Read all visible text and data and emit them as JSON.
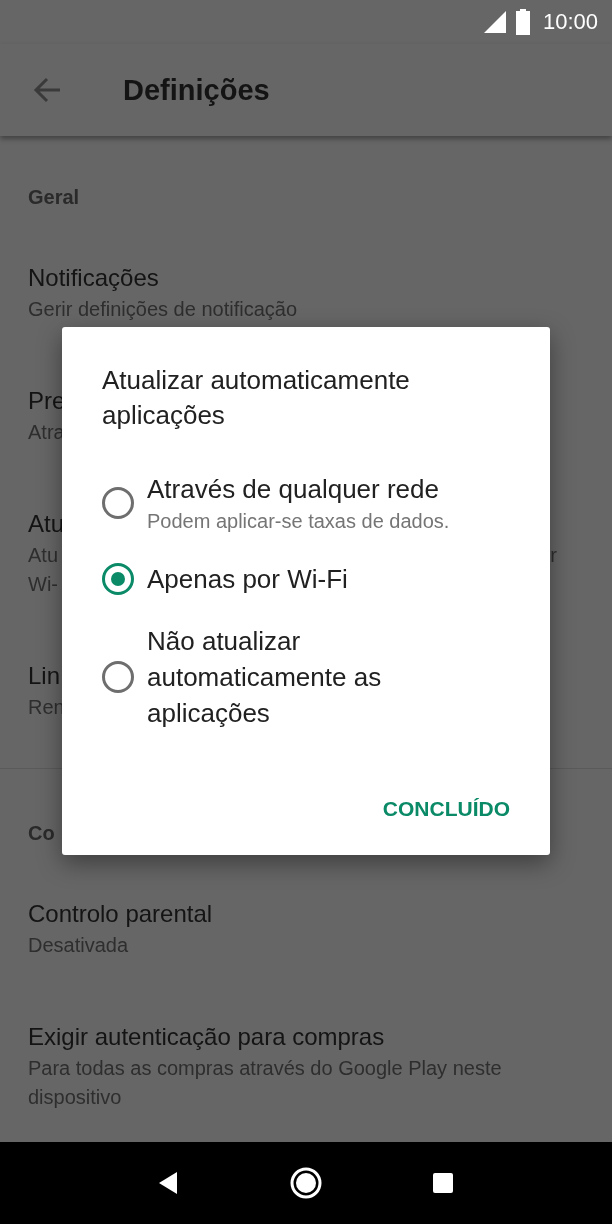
{
  "status_bar": {
    "time": "10:00"
  },
  "app_bar": {
    "title": "Definições"
  },
  "sections": [
    {
      "header": "Geral",
      "items": [
        {
          "title": "Notificações",
          "subtitle_lines": [
            [
              "Gerir definições de notificação"
            ]
          ]
        },
        {
          "title": "Pre",
          "subtitle_lines": [
            [
              "Atra"
            ]
          ]
        },
        {
          "title": "Atu",
          "subtitle_lines": [
            [
              "Atu",
              "r"
            ],
            [
              "Wi-"
            ]
          ]
        },
        {
          "title": "Lin",
          "subtitle_lines": [
            [
              "Ren"
            ]
          ]
        }
      ]
    },
    {
      "header": "Co",
      "items": [
        {
          "title": "Controlo parental",
          "subtitle_lines": [
            [
              "Desativada"
            ]
          ]
        },
        {
          "title": "Exigir autenticação para compras",
          "subtitle_lines": [
            [
              "Para todas as compras através do Google Play neste dispositivo"
            ]
          ]
        }
      ]
    }
  ],
  "dialog": {
    "title": "Atualizar automaticamente aplicações",
    "options": [
      {
        "label": "Através de qualquer rede",
        "description": "Podem aplicar-se taxas de dados.",
        "selected": false
      },
      {
        "label": "Apenas por Wi-Fi",
        "selected": true
      },
      {
        "label": "Não atualizar automaticamente as aplicações",
        "selected": false
      }
    ],
    "button": "CONCLUÍDO"
  }
}
